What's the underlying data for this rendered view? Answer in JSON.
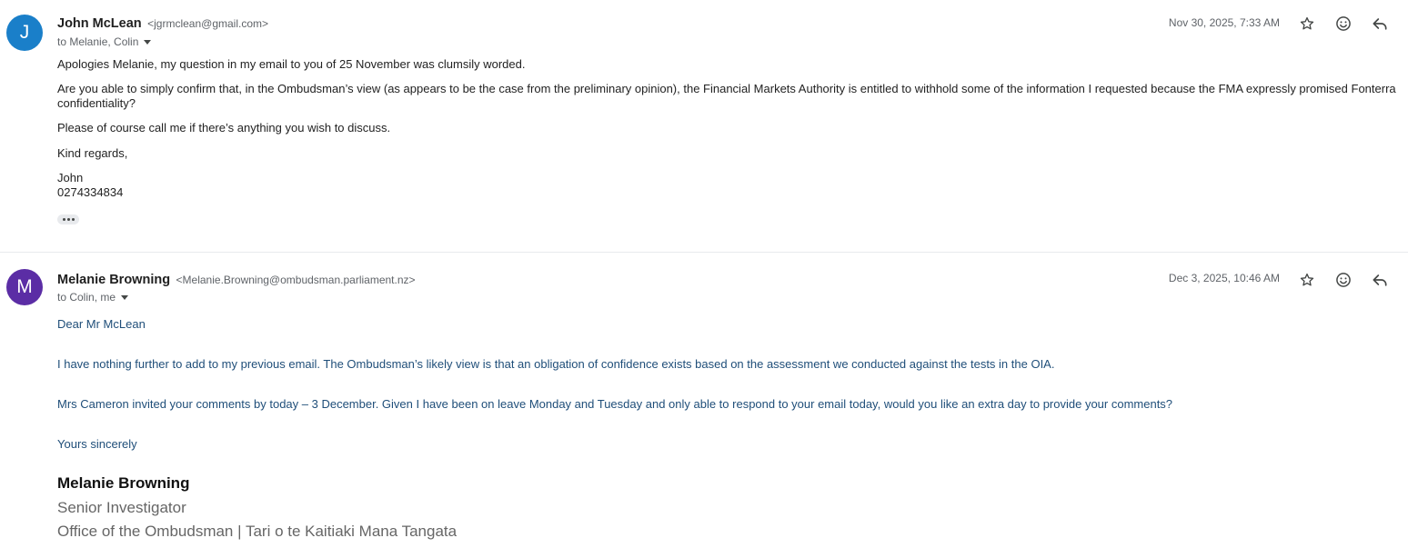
{
  "messages": [
    {
      "avatar_letter": "J",
      "avatar_color": "#1a7fc9",
      "sender_name": "John McLean",
      "sender_email": "<jgrmclean@gmail.com>",
      "to": "to Melanie, Colin",
      "date": "Nov 30, 2025, 7:33 AM",
      "body": [
        "Apologies Melanie, my question in my email to you of 25 November was clumsily worded.",
        "Are you able to simply confirm that, in the Ombudsman’s view (as appears to be the case from the preliminary opinion), the Financial Markets Authority is entitled to withhold some of the information I requested because the FMA expressly promised Fonterra confidentiality?",
        "Please of course call me if there’s anything you wish to discuss.",
        "Kind regards,",
        "John",
        "0274334834"
      ]
    },
    {
      "avatar_letter": "M",
      "avatar_color": "#5b2da5",
      "sender_name": "Melanie Browning",
      "sender_email": "<Melanie.Browning@ombudsman.parliament.nz>",
      "to": "to Colin, me",
      "date": "Dec 3, 2025, 10:46 AM",
      "body": [
        "Dear Mr McLean",
        "I have nothing further to add to my previous email. The Ombudsman’s likely view is that an obligation of confidence exists based on the assessment we conducted against the tests in the OIA.",
        "Mrs Cameron invited your comments by today – 3 December. Given I have been on leave Monday and Tuesday and only able to respond to your email today, would you like an extra day to provide your comments?",
        "Yours sincerely"
      ],
      "signature": {
        "name": "Melanie Browning",
        "title": "Senior Investigator",
        "org": "Office of the Ombudsman | Tari o te Kaitiaki Mana Tangata"
      }
    }
  ],
  "icons": {
    "star": "star-icon",
    "emoji": "emoji-icon",
    "reply": "reply-icon",
    "more": "more-horiz-icon",
    "caret": "caret-down-icon"
  }
}
